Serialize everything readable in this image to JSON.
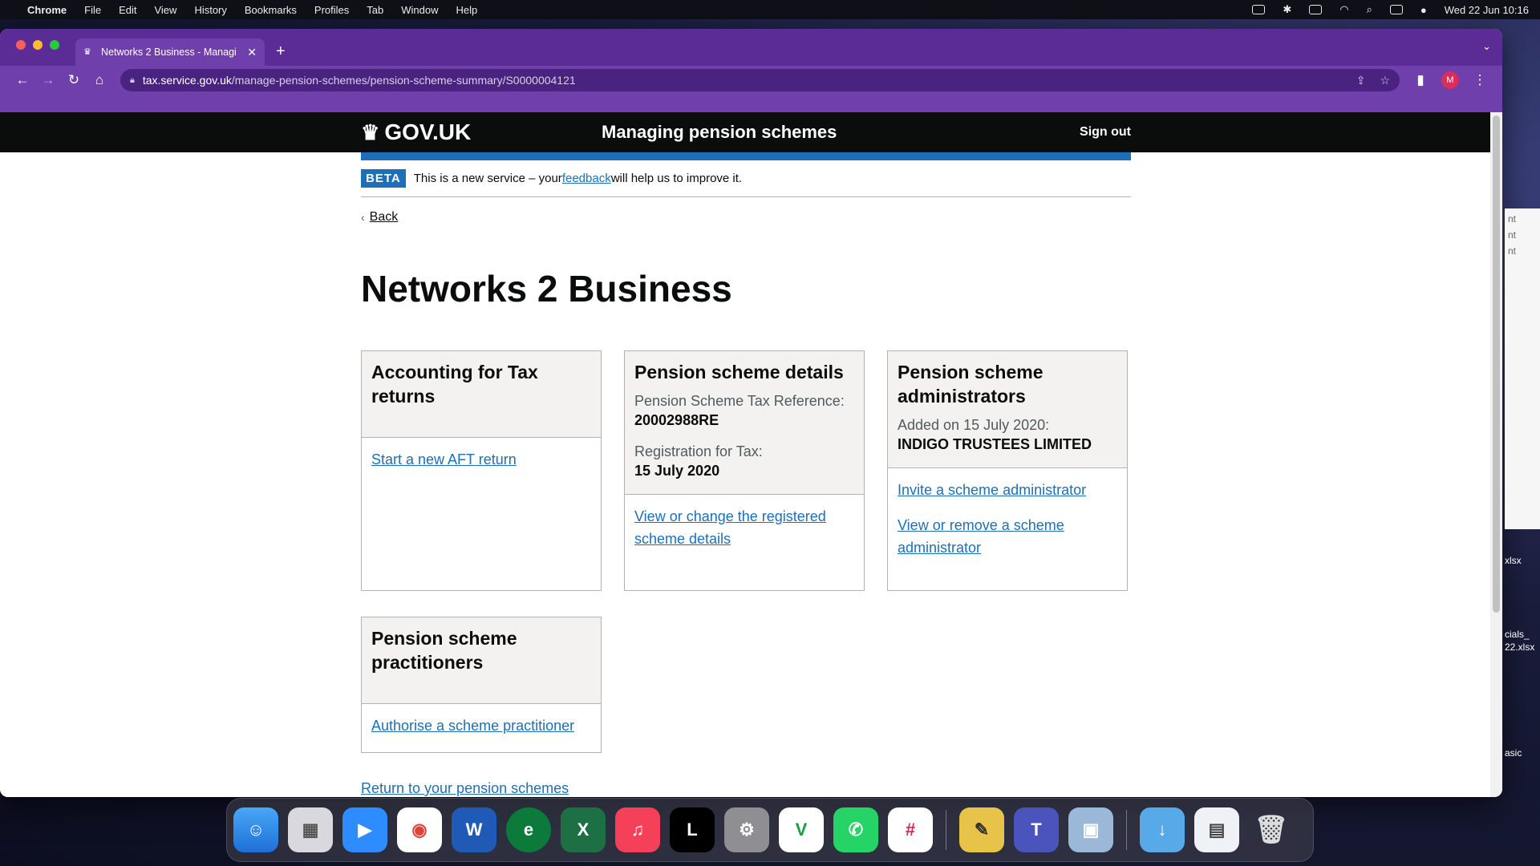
{
  "menubar": {
    "app_name": "Chrome",
    "menus": [
      "File",
      "Edit",
      "View",
      "History",
      "Bookmarks",
      "Profiles",
      "Tab",
      "Window",
      "Help"
    ],
    "clock": "Wed 22 Jun  10:16"
  },
  "browser": {
    "tab_title": "Networks 2 Business - Managi",
    "url_host": "tax.service.gov.uk",
    "url_path": "/manage-pension-schemes/pension-scheme-summary/S0000004121",
    "profile_initial": "M"
  },
  "gov_header": {
    "logo_text": "GOV.UK",
    "service_name": "Managing pension schemes",
    "sign_out": "Sign out"
  },
  "phase_banner": {
    "tag": "BETA",
    "text_before": "This is a new service – your ",
    "link": "feedback",
    "text_after": " will help us to improve it."
  },
  "back_link": "Back",
  "page_title": "Networks 2 Business",
  "cards": {
    "aft": {
      "title": "Accounting for Tax returns",
      "links": [
        "Start a new AFT return"
      ]
    },
    "details": {
      "title": "Pension scheme details",
      "meta1_label": "Pension Scheme Tax Reference:",
      "meta1_value": "20002988RE",
      "meta2_label": "Registration for Tax:",
      "meta2_value": "15 July 2020",
      "links": [
        "View or change the registered scheme details"
      ]
    },
    "admins": {
      "title": "Pension scheme administrators",
      "meta_label": "Added on 15 July 2020:",
      "meta_value": "INDIGO TRUSTEES LIMITED",
      "links": [
        "Invite a scheme administrator",
        "View or remove a scheme administrator"
      ]
    },
    "practitioners": {
      "title": "Pension scheme practitioners",
      "links": [
        "Authorise a scheme practitioner"
      ]
    }
  },
  "return_link": "Return to your pension schemes",
  "desktop_fragments": [
    "nt",
    "nt",
    "nt",
    "xlsx",
    "cials_",
    "22.xlsx",
    "asic"
  ],
  "dock_apps": [
    "Finder",
    "Launchpad",
    "Zoom",
    "Chrome",
    "Word",
    "Edge Dev",
    "Excel",
    "Music",
    "Letterboxd",
    "System Preferences",
    "Vectorworks",
    "WhatsApp",
    "Slack",
    "ColorSync",
    "Teams",
    "Preview",
    "Downloads",
    "Chrome App",
    "Trash"
  ]
}
